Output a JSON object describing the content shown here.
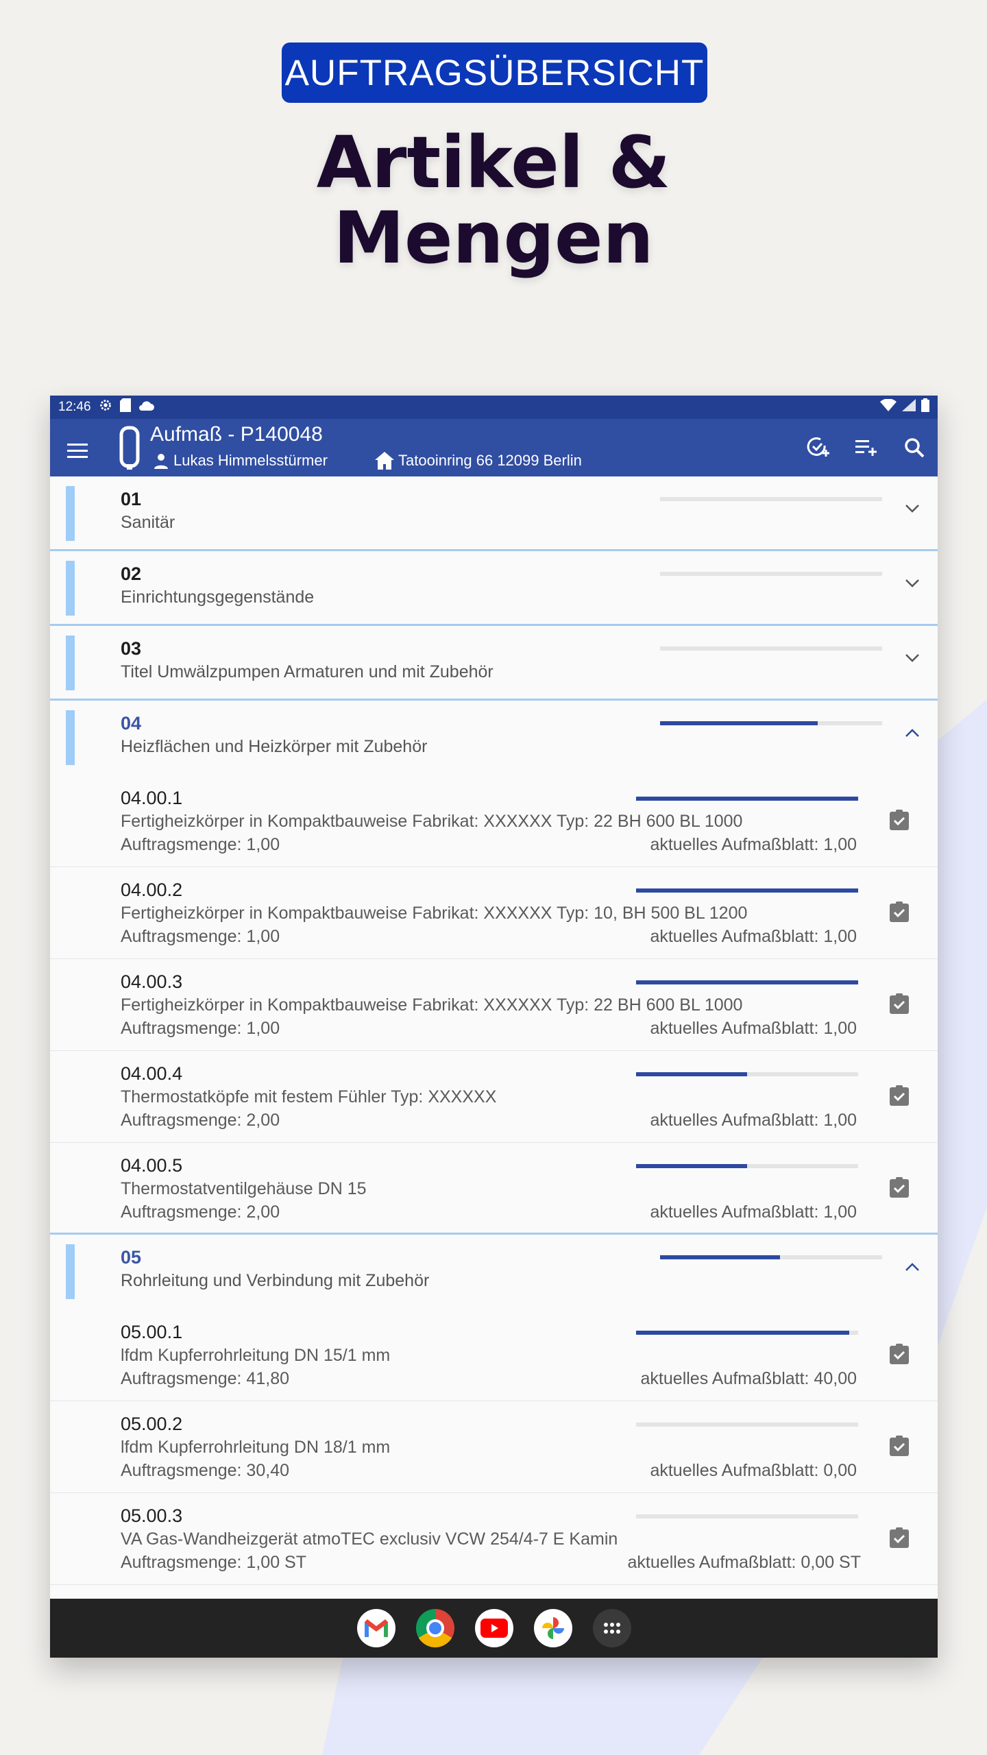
{
  "hero": {
    "badge": "AUFTRAGSÜBERSICHT",
    "title_line1": "Artikel &",
    "title_line2": "Mengen"
  },
  "statusbar": {
    "time": "12:46"
  },
  "appbar": {
    "title": "Aufmaß - P140048",
    "person": "Lukas Himmelsstürmer",
    "address": "Tatooinring 66 12099 Berlin"
  },
  "colors": {
    "primary": "#304ea2",
    "accent": "#9fcdf7",
    "badge": "#0b38b8",
    "progress": "#2d4aa0"
  },
  "groups": [
    {
      "num": "01",
      "name": "Sanitär",
      "progress": 0,
      "expanded": false
    },
    {
      "num": "02",
      "name": "Einrichtungsgegenstände",
      "progress": 0,
      "expanded": false
    },
    {
      "num": "03",
      "name": "Titel Umwälzpumpen Armaturen und mit Zubehör",
      "progress": 0,
      "expanded": false
    },
    {
      "num": "04",
      "name": "Heizflächen und Heizkörper mit Zubehör",
      "progress": 0.71,
      "expanded": true,
      "items": [
        {
          "code": "04.00.1",
          "desc": "Fertigheizkörper in Kompaktbauweise Fabrikat: XXXXXX Typ: 22 BH 600 BL 1000",
          "qty": "Auftragsmenge: 1,00",
          "current": "aktuelles Aufmaßblatt: 1,00",
          "progress": 1.0
        },
        {
          "code": "04.00.2",
          "desc": "Fertigheizkörper in Kompaktbauweise Fabrikat: XXXXXX Typ: 10, BH 500 BL 1200",
          "qty": "Auftragsmenge: 1,00",
          "current": "aktuelles Aufmaßblatt: 1,00",
          "progress": 1.0
        },
        {
          "code": "04.00.3",
          "desc": "Fertigheizkörper in Kompaktbauweise Fabrikat: XXXXXX Typ: 22 BH 600 BL 1000",
          "qty": "Auftragsmenge: 1,00",
          "current": "aktuelles Aufmaßblatt: 1,00",
          "progress": 1.0
        },
        {
          "code": "04.00.4",
          "desc": "Thermostatköpfe mit festem Fühler Typ: XXXXXX",
          "qty": "Auftragsmenge: 2,00",
          "current": "aktuelles Aufmaßblatt: 1,00",
          "progress": 0.5
        },
        {
          "code": "04.00.5",
          "desc": "Thermostatventilgehäuse DN 15",
          "qty": "Auftragsmenge: 2,00",
          "current": "aktuelles Aufmaßblatt: 1,00",
          "progress": 0.5
        }
      ]
    },
    {
      "num": "05",
      "name": "Rohrleitung und Verbindung mit Zubehör",
      "progress": 0.54,
      "expanded": true,
      "items": [
        {
          "code": "05.00.1",
          "desc": "lfdm Kupferrohrleitung DN 15/1 mm",
          "qty": "Auftragsmenge: 41,80",
          "current": "aktuelles Aufmaßblatt: 40,00",
          "progress": 0.96
        },
        {
          "code": "05.00.2",
          "desc": "lfdm Kupferrohrleitung DN 18/1 mm",
          "qty": "Auftragsmenge: 30,40",
          "current": "aktuelles Aufmaßblatt: 0,00",
          "progress": 0
        },
        {
          "code": "05.00.3",
          "desc": "VA Gas-Wandheizgerät atmoTEC exclusiv VCW 254/4-7 E Kamin",
          "qty": "Auftragsmenge: 1,00 ST",
          "current": "aktuelles Aufmaßblatt: 0,00 ST",
          "progress": 0
        }
      ]
    }
  ],
  "dock": [
    "gmail-icon",
    "chrome-icon",
    "youtube-icon",
    "photos-icon",
    "app-drawer-icon"
  ]
}
